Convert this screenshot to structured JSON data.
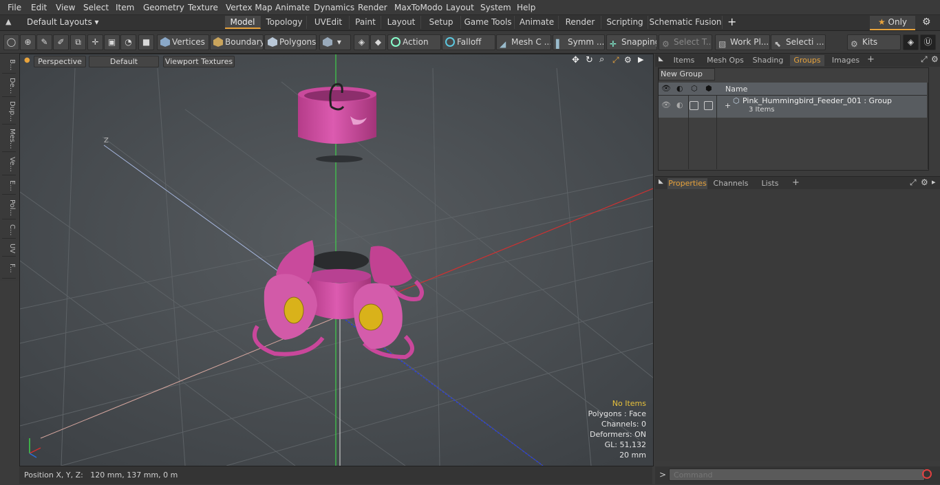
{
  "menu": [
    "File",
    "Edit",
    "View",
    "Select",
    "Item",
    "Geometry",
    "Texture",
    "Vertex Map",
    "Animate",
    "Dynamics",
    "Render",
    "MaxToModo",
    "Layout",
    "System",
    "Help"
  ],
  "layout_selector": "Default Layouts",
  "mode_tabs": [
    "Model",
    "Topology",
    "UVEdit",
    "Paint",
    "Layout",
    "Setup",
    "Game Tools",
    "Animate",
    "Render",
    "Scripting",
    "Schematic Fusion"
  ],
  "mode_active": "Model",
  "only_label": "Only",
  "toolbar": {
    "vertices": "Vertices",
    "boundary": "Boundary",
    "polygons": "Polygons",
    "action": "Action",
    "falloff": "Falloff",
    "mesh": "Mesh C ...",
    "symm": "Symm ...",
    "snapping": "Snapping",
    "select_t": "Select T...",
    "work_pl": "Work Pl...",
    "selecti": "Selecti ...",
    "kits": "Kits"
  },
  "left_strip": [
    "B...",
    "De...",
    "Dup...",
    "Mes...",
    "Ve...",
    "E...",
    "Pol...",
    "C...",
    "UV",
    "F..."
  ],
  "viewport": {
    "view": "Perspective",
    "shading": "Default",
    "textures": "Viewport Textures",
    "axis_label_z": "Z",
    "stats": {
      "items": "No Items",
      "polygons": "Polygons : Face",
      "channels": "Channels: 0",
      "deformers": "Deformers: ON",
      "gl": "GL: 51,132",
      "scale": "20 mm"
    }
  },
  "status": {
    "position": "Position X, Y, Z:   120 mm, 137 mm, 0 m"
  },
  "right_tabs": [
    "Items",
    "Mesh Ops",
    "Shading",
    "Groups",
    "Images"
  ],
  "right_active": "Groups",
  "groups": {
    "new_group": "New Group",
    "col_name": "Name",
    "item_name": "Pink_Hummingbird_Feeder_001 : Group",
    "item_count": "3 Items"
  },
  "bottom_tabs": [
    "Properties",
    "Channels",
    "Lists"
  ],
  "bottom_active": "Properties",
  "command_placeholder": "Command",
  "colors": {
    "accent": "#e8a33c",
    "feeder_pink": "#c9479b",
    "flower_yellow": "#d9b21a"
  }
}
